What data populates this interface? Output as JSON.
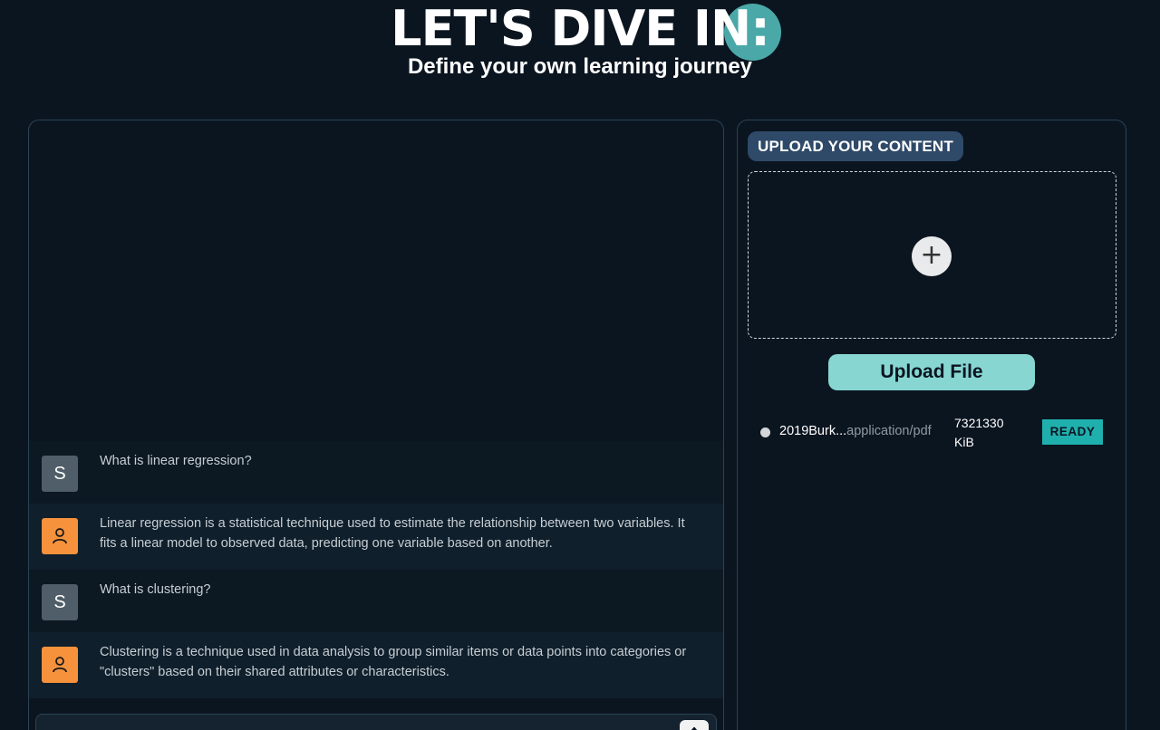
{
  "header": {
    "title": "LET'S DIVE IN:",
    "subtitle": "Define your own learning journey"
  },
  "colors": {
    "background": "#0b1520",
    "accent_teal": "#4aa9a8",
    "upload_button": "#87d6d2",
    "ready_badge": "#1fb0ae",
    "bot_avatar": "#f7923c",
    "user_avatar": "#4f5e68"
  },
  "chat": {
    "messages": [
      {
        "role": "user",
        "avatar": "S",
        "text": "What is linear regression?"
      },
      {
        "role": "bot",
        "avatar_icon": "person-icon",
        "text": "Linear regression is a statistical technique used to estimate the relationship between two variables. It fits a linear model to observed data, predicting one variable based on another."
      },
      {
        "role": "user",
        "avatar": "S",
        "text": "What is clustering?"
      },
      {
        "role": "bot",
        "avatar_icon": "person-icon",
        "text": "Clustering is a technique used in data analysis to group similar items or data points into categories or \"clusters\" based on their shared attributes or characteristics."
      }
    ],
    "input": {
      "value": "",
      "placeholder": ""
    },
    "send_icon": "arrow-up-icon"
  },
  "upload": {
    "badge": "UPLOAD YOUR CONTENT",
    "dropzone_icon": "plus-icon",
    "button_label": "Upload File",
    "files": [
      {
        "name": "2019Burk...",
        "type": "application/pdf",
        "size_value": "7321330",
        "size_unit": "KiB",
        "status": "READY"
      }
    ]
  }
}
